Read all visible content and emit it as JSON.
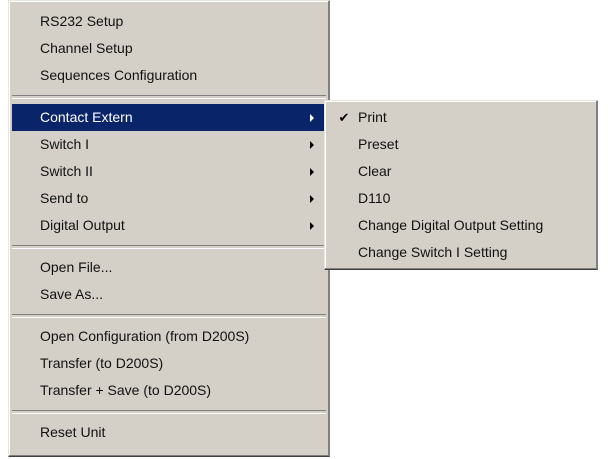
{
  "main_menu": {
    "items": [
      {
        "label": "RS232 Setup"
      },
      {
        "label": "Channel Setup"
      },
      {
        "label": "Sequences Configuration"
      },
      {
        "label": "Contact Extern"
      },
      {
        "label": "Switch I"
      },
      {
        "label": "Switch II"
      },
      {
        "label": "Send to"
      },
      {
        "label": "Digital Output"
      },
      {
        "label": "Open File..."
      },
      {
        "label": "Save As..."
      },
      {
        "label": "Open Configuration (from D200S)"
      },
      {
        "label": "Transfer (to D200S)"
      },
      {
        "label": "Transfer + Save (to D200S)"
      },
      {
        "label": "Reset Unit"
      }
    ],
    "selected_label": "Contact Extern"
  },
  "sub_menu": {
    "items": [
      {
        "label": "Print"
      },
      {
        "label": "Preset"
      },
      {
        "label": "Clear"
      },
      {
        "label": "D110"
      },
      {
        "label": "Change Digital Output Setting"
      },
      {
        "label": "Change Switch I Setting"
      }
    ],
    "checked_label": "Print",
    "check_icon": "checkmark-icon",
    "check_glyph": "✔"
  },
  "colors": {
    "menu_background": "#d4d0c8",
    "highlight": "#0a246a",
    "highlight_text": "#ffffff"
  }
}
